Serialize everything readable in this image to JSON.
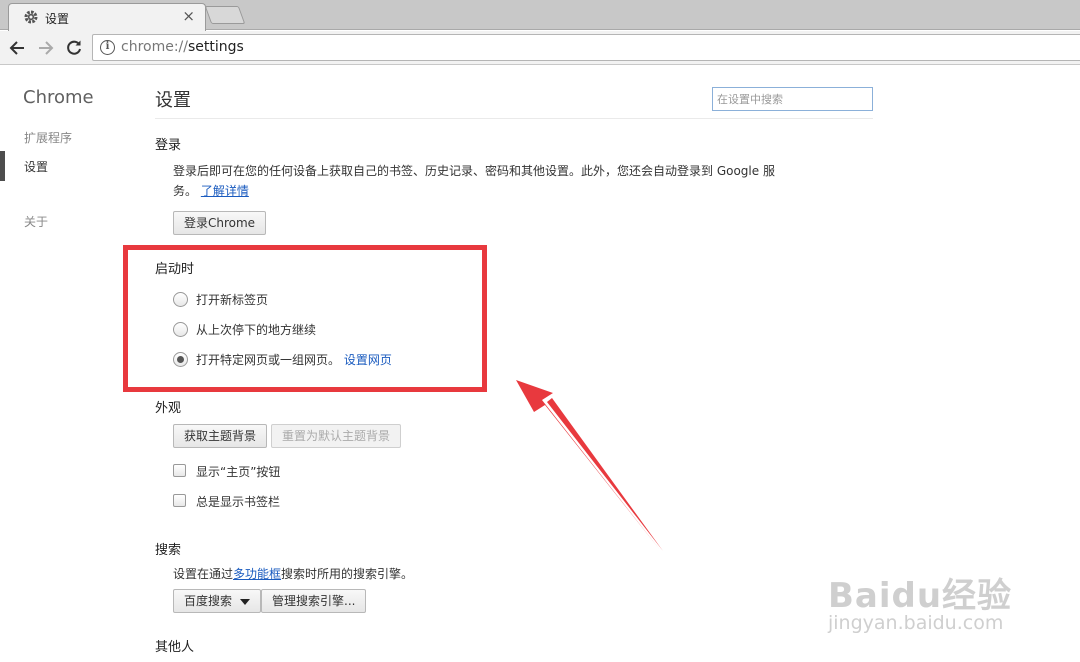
{
  "browser": {
    "tab_title": "设置",
    "tab_close": "×",
    "url_scheme": "chrome://",
    "url_path": "settings"
  },
  "sidebar": {
    "title": "Chrome",
    "items": [
      {
        "label": "扩展程序",
        "active": false
      },
      {
        "label": "设置",
        "active": true
      },
      {
        "label": "关于",
        "active": false
      }
    ]
  },
  "main": {
    "title": "设置",
    "search_placeholder": "在设置中搜索",
    "signin": {
      "title": "登录",
      "desc_line1": "登录后即可在您的任何设备上获取自己的书签、历史记录、密码和其他设置。此外，您还会自动登录到 Google 服",
      "desc_line2": "务。",
      "learn_more": "了解详情",
      "button": "登录Chrome"
    },
    "startup": {
      "title": "启动时",
      "options": [
        {
          "label": "打开新标签页",
          "checked": false
        },
        {
          "label": "从上次停下的地方继续",
          "checked": false
        },
        {
          "label": "打开特定网页或一组网页。",
          "checked": true
        }
      ],
      "set_pages_link": "设置网页"
    },
    "appearance": {
      "title": "外观",
      "get_themes": "获取主题背景",
      "reset_theme": "重置为默认主题背景",
      "show_home": "显示“主页”按钮",
      "show_bookmarks": "总是显示书签栏"
    },
    "search_section": {
      "title": "搜索",
      "desc_prefix": "设置在通过",
      "desc_link": "多功能框",
      "desc_suffix": "搜索时所用的搜索引擎。",
      "engine": "百度搜索",
      "manage": "管理搜索引擎..."
    },
    "people": {
      "title": "其他人"
    }
  },
  "watermark": {
    "main": "Baidu经验",
    "sub": "jingyan.baidu.com"
  },
  "colors": {
    "annotation_red": "#e8393e",
    "link_blue": "#1a5bbf"
  }
}
